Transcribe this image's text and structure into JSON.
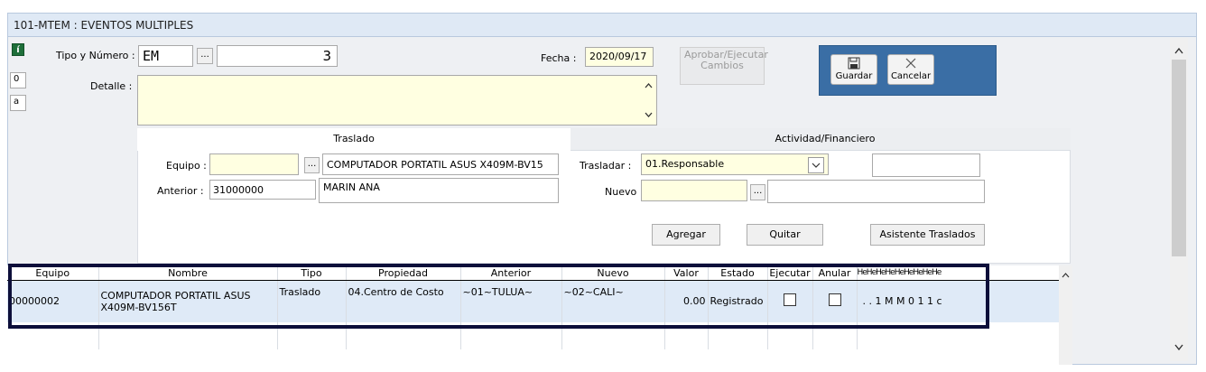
{
  "window": {
    "title": "101-MTEM : EVENTOS MULTIPLES"
  },
  "side": {
    "info_icon": "í",
    "counter": "0",
    "letter": "a"
  },
  "header": {
    "tipo_label": "Tipo y Número :",
    "tipo_value": "EM",
    "ellipsis": "...",
    "numero_value": "3",
    "fecha_label": "Fecha :",
    "fecha_value": "2020/09/17",
    "detalle_label": "Detalle :",
    "detalle_value": "",
    "aprobar_label": "Aprobar/Ejecutar Cambios"
  },
  "toolbar": {
    "guardar_label": "Guardar",
    "cancelar_label": "Cancelar"
  },
  "traslado": {
    "tab_label": "Traslado",
    "equipo_label": "Equipo :",
    "equipo_value": "",
    "equipo_desc": "COMPUTADOR PORTATIL ASUS X409M-BV15",
    "anterior_label": "Anterior :",
    "anterior_value": "31000000",
    "anterior_desc": "MARIN ANA"
  },
  "actividad": {
    "tab_label": "Actividad/Financiero",
    "trasladar_label": "Trasladar :",
    "trasladar_value": "01.Responsable",
    "extra_value": "",
    "nuevo_label": "Nuevo :",
    "nuevo_value": "",
    "nuevo_desc": ""
  },
  "actions": {
    "agregar": "Agregar",
    "quitar": "Quitar",
    "asistente": "Asistente Traslados"
  },
  "grid": {
    "headers": [
      "Equipo",
      "Nombre",
      "Tipo",
      "Propiedad",
      "Anterior",
      "Nuevo",
      "Valor",
      "Estado",
      "Ejecutar",
      "Anular",
      "HeHeHeHeHeHeHeHeHe"
    ],
    "rows": [
      {
        "equipo": "00000002",
        "nombre": "COMPUTADOR PORTATIL ASUS X409M-BV156T",
        "tipo": "Traslado",
        "propiedad": "04.Centro de Costo",
        "anterior": "~01~TULUA~",
        "nuevo": "~02~CALI~",
        "valor": "0.00",
        "estado": "Registrado",
        "extra": ". . 1 M M 0 1 1 c"
      }
    ]
  },
  "colors": {
    "accent_panel": "#3a6ea5",
    "highlight_border": "#0d0f3a",
    "input_yellow": "#ffffe1"
  },
  "icons": {
    "up": "chevron-up-icon",
    "down": "chevron-down-icon",
    "save": "floppy-disk-icon",
    "cancel": "cross-icon"
  }
}
